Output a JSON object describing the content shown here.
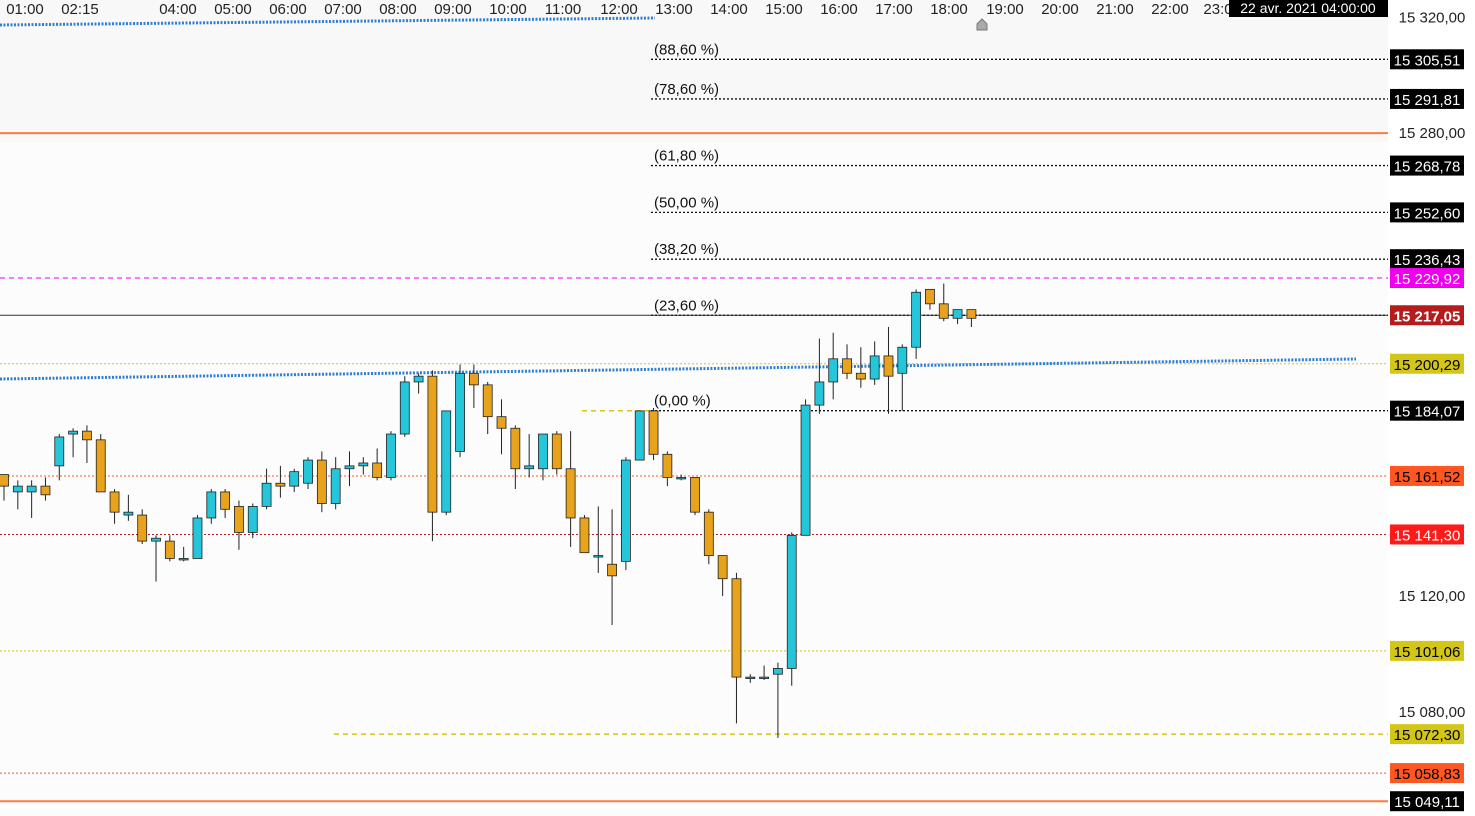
{
  "cursor_time_label": "22 avr. 2021 04:00:00",
  "time_axis": [
    "01:00",
    "02:15",
    "04:00",
    "05:00",
    "06:00",
    "07:00",
    "08:00",
    "09:00",
    "10:00",
    "11:00",
    "12:00",
    "13:00",
    "14:00",
    "15:00",
    "16:00",
    "17:00",
    "18:00",
    "19:00",
    "20:00",
    "21:00",
    "22:00",
    "23:0"
  ],
  "colors": {
    "bull": "#26c6da",
    "bear": "#e8a21b",
    "last_price_bg": "#b71c1c",
    "red_label_bg": "#ff1a1a",
    "orange_label_bg": "#ff5722",
    "yellow_label_bg": "#d4c619",
    "magenta_label_bg": "#ee00ee",
    "black_label_bg": "#000000",
    "orange_line": "#ff7a3d",
    "trend_line": "#2f7fd6"
  },
  "chart_data": {
    "type": "candlestick",
    "instrument_last_price": 15217.05,
    "ylim": [
      15044,
      15326
    ],
    "y_ticks": [
      "15 320,00",
      "15 280,00",
      "15 120,00",
      "15 080,00"
    ],
    "candles": [
      {
        "o": 15162,
        "h": 15162,
        "l": 15153,
        "c": 15158
      },
      {
        "o": 15156,
        "h": 15160,
        "l": 15150,
        "c": 15158
      },
      {
        "o": 15156,
        "h": 15160,
        "l": 15147,
        "c": 15158
      },
      {
        "o": 15158,
        "h": 15161,
        "l": 15153,
        "c": 15155
      },
      {
        "o": 15165,
        "h": 15176,
        "l": 15160,
        "c": 15175
      },
      {
        "o": 15176,
        "h": 15178,
        "l": 15168,
        "c": 15177
      },
      {
        "o": 15177,
        "h": 15179,
        "l": 15166,
        "c": 15174
      },
      {
        "o": 15174,
        "h": 15176,
        "l": 15156,
        "c": 15156
      },
      {
        "o": 15156,
        "h": 15157,
        "l": 15145,
        "c": 15149
      },
      {
        "o": 15148,
        "h": 15155,
        "l": 15146,
        "c": 15149
      },
      {
        "o": 15148,
        "h": 15150,
        "l": 15138,
        "c": 15139
      },
      {
        "o": 15139,
        "h": 15141,
        "l": 15125,
        "c": 15140
      },
      {
        "o": 15139,
        "h": 15141,
        "l": 15132,
        "c": 15133
      },
      {
        "o": 15133,
        "h": 15137,
        "l": 15132,
        "c": 15133
      },
      {
        "o": 15133,
        "h": 15148,
        "l": 15133,
        "c": 15147
      },
      {
        "o": 15147,
        "h": 15157,
        "l": 15145,
        "c": 15156
      },
      {
        "o": 15156,
        "h": 15157,
        "l": 15147,
        "c": 15150
      },
      {
        "o": 15151,
        "h": 15153,
        "l": 15136,
        "c": 15142
      },
      {
        "o": 15142,
        "h": 15152,
        "l": 15140,
        "c": 15151
      },
      {
        "o": 15151,
        "h": 15164,
        "l": 15150,
        "c": 15159
      },
      {
        "o": 15159,
        "h": 15165,
        "l": 15154,
        "c": 15158
      },
      {
        "o": 15158,
        "h": 15164,
        "l": 15156,
        "c": 15163
      },
      {
        "o": 15159,
        "h": 15168,
        "l": 15157,
        "c": 15167
      },
      {
        "o": 15167,
        "h": 15170,
        "l": 15149,
        "c": 15152
      },
      {
        "o": 15152,
        "h": 15168,
        "l": 15150,
        "c": 15164
      },
      {
        "o": 15164,
        "h": 15170,
        "l": 15158,
        "c": 15165
      },
      {
        "o": 15165,
        "h": 15168,
        "l": 15162,
        "c": 15166
      },
      {
        "o": 15166,
        "h": 15171,
        "l": 15160,
        "c": 15161
      },
      {
        "o": 15161,
        "h": 15177,
        "l": 15160,
        "c": 15176
      },
      {
        "o": 15176,
        "h": 15196,
        "l": 15175,
        "c": 15194
      },
      {
        "o": 15194,
        "h": 15197,
        "l": 15190,
        "c": 15196
      },
      {
        "o": 15196,
        "h": 15198,
        "l": 15139,
        "c": 15149
      },
      {
        "o": 15149,
        "h": 15178,
        "l": 15148,
        "c": 15184
      },
      {
        "o": 15170,
        "h": 15200,
        "l": 15168,
        "c": 15197
      },
      {
        "o": 15197,
        "h": 15200,
        "l": 15185,
        "c": 15193
      },
      {
        "o": 15193,
        "h": 15194,
        "l": 15176,
        "c": 15182
      },
      {
        "o": 15182,
        "h": 15188,
        "l": 15169,
        "c": 15178
      },
      {
        "o": 15178,
        "h": 15179,
        "l": 15157,
        "c": 15164
      },
      {
        "o": 15164,
        "h": 15176,
        "l": 15161,
        "c": 15165
      },
      {
        "o": 15164,
        "h": 15176,
        "l": 15160,
        "c": 15176
      },
      {
        "o": 15176,
        "h": 15177,
        "l": 15162,
        "c": 15164
      },
      {
        "o": 15164,
        "h": 15177,
        "l": 15137,
        "c": 15147
      },
      {
        "o": 15147,
        "h": 15148,
        "l": 15136,
        "c": 15135
      },
      {
        "o": 15134,
        "h": 15151,
        "l": 15128,
        "c": 15134
      },
      {
        "o": 15131,
        "h": 15150,
        "l": 15110,
        "c": 15127
      },
      {
        "o": 15132,
        "h": 15168,
        "l": 15129,
        "c": 15167
      },
      {
        "o": 15167,
        "h": 15184,
        "l": 15167,
        "c": 15184
      },
      {
        "o": 15184,
        "h": 15185,
        "l": 15167,
        "c": 15169
      },
      {
        "o": 15169,
        "h": 15170,
        "l": 15158,
        "c": 15161
      },
      {
        "o": 15161,
        "h": 15162,
        "l": 15160,
        "c": 15161
      },
      {
        "o": 15161,
        "h": 15161,
        "l": 15148,
        "c": 15149
      },
      {
        "o": 15149,
        "h": 15150,
        "l": 15131,
        "c": 15134
      },
      {
        "o": 15134,
        "h": 15134,
        "l": 15120,
        "c": 15126
      },
      {
        "o": 15126,
        "h": 15128,
        "l": 15076,
        "c": 15092
      },
      {
        "o": 15092,
        "h": 15093,
        "l": 15090,
        "c": 15092
      },
      {
        "o": 15092,
        "h": 15096,
        "l": 15091,
        "c": 15092
      },
      {
        "o": 15093,
        "h": 15097,
        "l": 15071,
        "c": 15095
      },
      {
        "o": 15095,
        "h": 15142,
        "l": 15089,
        "c": 15141
      },
      {
        "o": 15141,
        "h": 15188,
        "l": 15141,
        "c": 15186
      },
      {
        "o": 15186,
        "h": 15209,
        "l": 15183,
        "c": 15194
      },
      {
        "o": 15194,
        "h": 15211,
        "l": 15188,
        "c": 15202
      },
      {
        "o": 15202,
        "h": 15207,
        "l": 15195,
        "c": 15197
      },
      {
        "o": 15197,
        "h": 15206,
        "l": 15192,
        "c": 15195
      },
      {
        "o": 15195,
        "h": 15208,
        "l": 15193,
        "c": 15203
      },
      {
        "o": 15203,
        "h": 15213,
        "l": 15183,
        "c": 15196
      },
      {
        "o": 15197,
        "h": 15207,
        "l": 15184,
        "c": 15206
      },
      {
        "o": 15206,
        "h": 15226,
        "l": 15202,
        "c": 15225
      },
      {
        "o": 15226,
        "h": 15226,
        "l": 15219,
        "c": 15221
      },
      {
        "o": 15221,
        "h": 15228,
        "l": 15215,
        "c": 15216
      },
      {
        "o": 15216,
        "h": 15219,
        "l": 15214,
        "c": 15219
      },
      {
        "o": 15219,
        "h": 15219,
        "l": 15213,
        "c": 15216
      }
    ],
    "fibonacci": [
      {
        "label": "(88,60 %)",
        "price": 15305.51
      },
      {
        "label": "(78,60 %)",
        "price": 15291.81
      },
      {
        "label": "(61,80 %)",
        "price": 15268.78
      },
      {
        "label": "(50,00 %)",
        "price": 15252.6
      },
      {
        "label": "(38,20 %)",
        "price": 15236.43
      },
      {
        "label": "(23,60 %)",
        "price": 15217.05
      },
      {
        "label": "(0,00 %)",
        "price": 15184.07
      }
    ],
    "price_labels": [
      {
        "text": "15 305,51",
        "price": 15305.51,
        "bg": "#000000",
        "fg": "#ffffff"
      },
      {
        "text": "15 291,81",
        "price": 15291.81,
        "bg": "#000000",
        "fg": "#ffffff"
      },
      {
        "text": "15 268,78",
        "price": 15268.78,
        "bg": "#000000",
        "fg": "#ffffff"
      },
      {
        "text": "15 252,60",
        "price": 15252.6,
        "bg": "#000000",
        "fg": "#ffffff"
      },
      {
        "text": "15 236,43",
        "price": 15236.43,
        "bg": "#000000",
        "fg": "#ffffff"
      },
      {
        "text": "15 229,92",
        "price": 15229.92,
        "bg": "#ee00ee",
        "fg": "#ffffff"
      },
      {
        "text": "15 217,05",
        "price": 15217.05,
        "bg": "#b71c1c",
        "fg": "#ffffff"
      },
      {
        "text": "15 200,29",
        "price": 15200.29,
        "bg": "#d4c619",
        "fg": "#000000"
      },
      {
        "text": "15 184,07",
        "price": 15184.07,
        "bg": "#000000",
        "fg": "#ffffff"
      },
      {
        "text": "15 161,52",
        "price": 15161.52,
        "bg": "#ff5722",
        "fg": "#000000"
      },
      {
        "text": "15 141,30",
        "price": 15141.3,
        "bg": "#ff1a1a",
        "fg": "#ffffff"
      },
      {
        "text": "15 101,06",
        "price": 15101.06,
        "bg": "#d4c619",
        "fg": "#000000"
      },
      {
        "text": "15 072,30",
        "price": 15072.3,
        "bg": "#d4c619",
        "fg": "#000000"
      },
      {
        "text": "15 058,83",
        "price": 15058.83,
        "bg": "#ff5722",
        "fg": "#000000"
      },
      {
        "text": "15 049,11",
        "price": 15049.11,
        "bg": "#000000",
        "fg": "#ffffff"
      }
    ],
    "horizontal_lines": [
      {
        "price": 15280.0,
        "color": "#ff7a3d",
        "style": "solid"
      },
      {
        "price": 15229.92,
        "color": "#ee00ee",
        "style": "dashed"
      },
      {
        "price": 15217.05,
        "color": "#333333",
        "style": "solid"
      },
      {
        "price": 15200.29,
        "color": "#d4c619",
        "style": "dotted"
      },
      {
        "price": 15161.52,
        "color": "#ff5722",
        "style": "dotted"
      },
      {
        "price": 15141.3,
        "color": "#b71c1c",
        "style": "dotted"
      },
      {
        "price": 15101.06,
        "color": "#d4c619",
        "style": "dotted"
      },
      {
        "price": 15058.83,
        "color": "#ff5722",
        "style": "dotted"
      },
      {
        "price": 15049.11,
        "color": "#ff7a3d",
        "style": "solid"
      }
    ]
  }
}
